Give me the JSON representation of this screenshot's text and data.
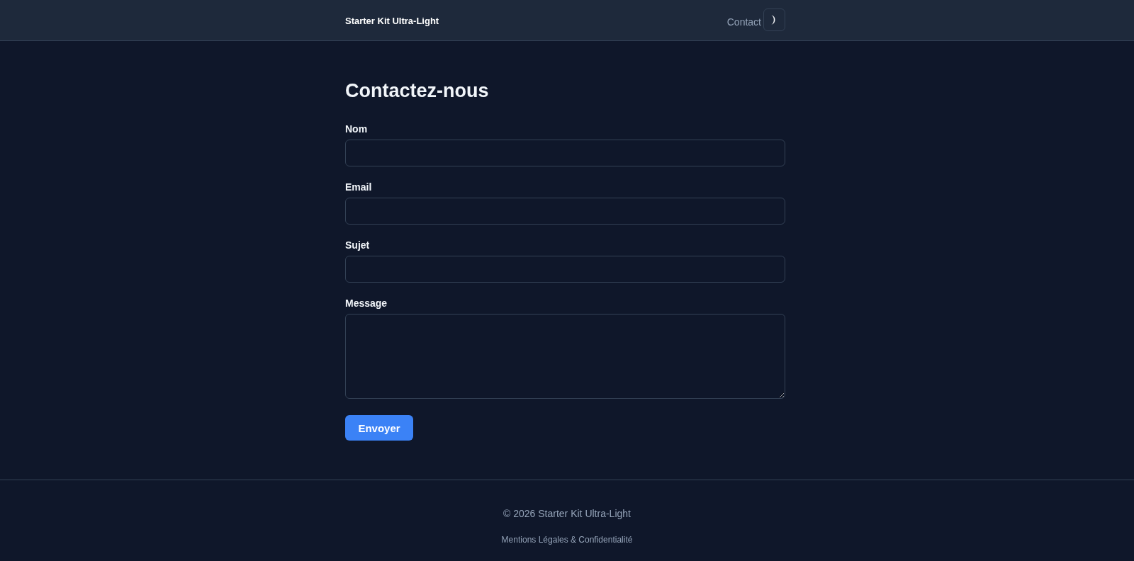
{
  "header": {
    "title": "Starter Kit Ultra-Light",
    "nav": [
      {
        "label": "Contact"
      }
    ]
  },
  "form": {
    "title": "Contactez-nous",
    "fields": [
      {
        "label": "Nom",
        "kind": "input"
      },
      {
        "label": "Email",
        "kind": "input"
      },
      {
        "label": "Sujet",
        "kind": "input"
      },
      {
        "label": "Message",
        "kind": "textarea"
      }
    ],
    "submit": "Envoyer"
  },
  "footer": {
    "copyright": "© 2026 Starter Kit Ultra-Light",
    "links": [
      "Mentions Légales & Confidentialité"
    ]
  }
}
